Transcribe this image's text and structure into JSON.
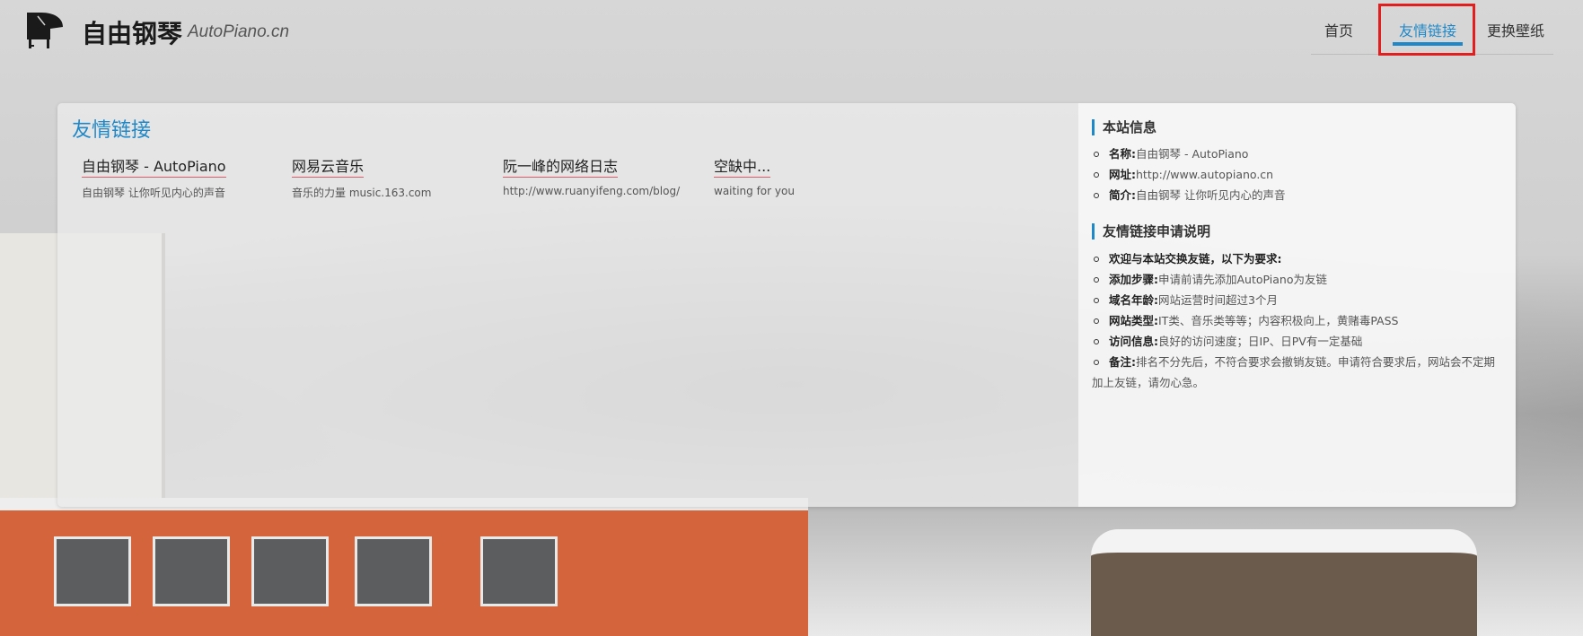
{
  "header": {
    "site_title": "自由钢琴",
    "site_subtitle": "AutoPiano.cn",
    "logo_icon": "grand-piano-icon"
  },
  "nav": {
    "items": [
      {
        "label": "首页"
      },
      {
        "label": "友情链接",
        "active": true
      },
      {
        "label": "更换壁纸"
      }
    ],
    "active_color": "#1e88c9",
    "highlight_color": "#e11f1f"
  },
  "main": {
    "title": "友情链接",
    "links": [
      {
        "name": "自由钢琴 - AutoPiano",
        "desc": "自由钢琴 让你听见内心的声音"
      },
      {
        "name": "网易云音乐",
        "desc": "音乐的力量 music.163.com"
      },
      {
        "name": "阮一峰的网络日志",
        "desc": "http://www.ruanyifeng.com/blog/"
      },
      {
        "name": "空缺中...",
        "desc": "waiting for you"
      }
    ]
  },
  "sidebar": {
    "site_info": {
      "heading": "本站信息",
      "items": [
        {
          "label": "名称:",
          "value": "自由钢琴 - AutoPiano"
        },
        {
          "label": "网址:",
          "value": "http://www.autopiano.cn"
        },
        {
          "label": "简介:",
          "value": "自由钢琴 让你听见内心的声音"
        }
      ]
    },
    "apply_info": {
      "heading": "友情链接申请说明",
      "intro": "欢迎与本站交换友链，以下为要求:",
      "items": [
        {
          "label": "添加步骤:",
          "value": "申请前请先添加AutoPiano为友链"
        },
        {
          "label": "域名年龄:",
          "value": "网站运营时间超过3个月"
        },
        {
          "label": "网站类型:",
          "value": "IT类、音乐类等等；内容积极向上，黄赌毒PASS"
        },
        {
          "label": "访问信息:",
          "value": "良好的访问速度；日IP、日PV有一定基础"
        },
        {
          "label": "备注:",
          "value": "排名不分先后，不符合要求会撤销友链。申请符合要求后，网站会不定期加上友链，请勿心急。"
        }
      ]
    }
  }
}
